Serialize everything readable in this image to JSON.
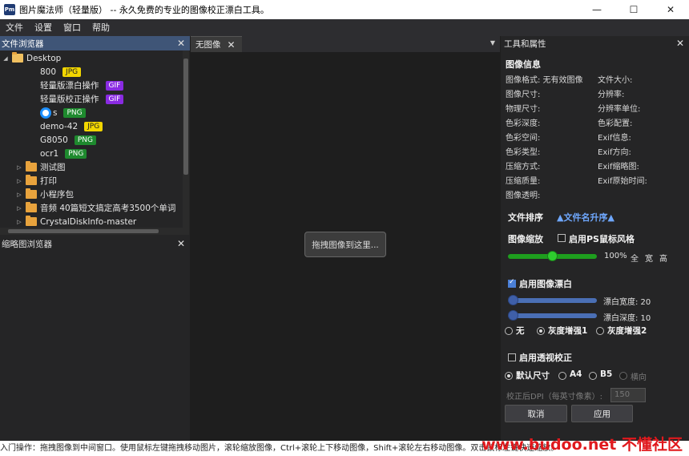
{
  "window": {
    "logo_text": "Pm",
    "title": "图片魔法师（轻量版） -- 永久免费的专业的图像校正漂白工具。",
    "minimize": "—",
    "maximize": "☐",
    "close": "✕"
  },
  "menu": [
    "文件",
    "设置",
    "窗口",
    "帮助"
  ],
  "file_browser": {
    "title": "文件浏览器",
    "close": "✕",
    "root": "Desktop",
    "files": [
      {
        "name": "800",
        "badge": "JPG"
      },
      {
        "name": "轻量版漂白操作",
        "badge": "GIF"
      },
      {
        "name": "轻量版校正操作",
        "badge": "GIF"
      },
      {
        "name": "s",
        "badge": "PNG"
      },
      {
        "name": "demo-42",
        "badge": "JPG"
      },
      {
        "name": "G8050",
        "badge": "PNG"
      },
      {
        "name": "ocr1",
        "badge": "PNG"
      }
    ],
    "folders": [
      "测试图",
      "打印",
      "小程序包",
      "音频 40篇短文搞定高考3500个单词",
      "CrystalDiskInfo-master"
    ]
  },
  "thumbnail_browser": {
    "title": "缩略图浏览器",
    "close": "✕"
  },
  "center": {
    "tab_label": "无图像",
    "tab_close": "✕",
    "dropdown": "▼",
    "drop_hint": "拖拽图像到这里..."
  },
  "tools": {
    "title": "工具和属性",
    "close": "✕",
    "image_info": {
      "title": "图像信息",
      "left": [
        "图像格式: 无有效图像",
        "图像尺寸:",
        "物理尺寸:",
        "色彩深度:",
        "色彩空间:",
        "色彩类型:",
        "压缩方式:",
        "压缩质量:",
        "图像透明:"
      ],
      "right": [
        "文件大小:",
        "分辨率:",
        "分辨率单位:",
        "色彩配置:",
        "Exif信息:",
        "Exif方向:",
        "Exif缩略图:",
        "Exif原始时间:"
      ]
    },
    "file_sort": {
      "label": "文件排序",
      "value": "▲文件名升序▲"
    },
    "zoom": {
      "label": "图像缩放",
      "ps_style": "启用PS鼠标风格",
      "value_text": "100%",
      "options": [
        "全",
        "宽",
        "高"
      ],
      "slider_fraction": 0.5
    },
    "whitening": {
      "enable_label": "启用图像漂白",
      "width_label": "漂白宽度: 20",
      "depth_label": "漂白深度: 10",
      "width_fraction": 0.0,
      "depth_fraction": 0.0,
      "modes": [
        "无",
        "灰度增强1",
        "灰度增强2"
      ],
      "selected_mode": 1
    },
    "perspective": {
      "enable_label": "启用透视校正",
      "sizes": [
        "默认尺寸",
        "A4",
        "B5",
        "横向"
      ],
      "selected_size": 0,
      "dpi_label": "校正后DPI（每英寸像素）:",
      "dpi_value": "150",
      "cancel": "取消",
      "apply": "应用"
    }
  },
  "status": "入门操作：拖拽图像到中间窗口。使用鼠标左键拖拽移动图片，滚轮缩放图像，Ctrl+滚轮上下移动图像，Shift+滚轮左右移动图像。双击鼠标左键快速缩放。",
  "watermark": "www.budoo.net 不懂社区",
  "colors": {
    "accent_green": "#1e9e1e",
    "accent_blue": "#3f5fa8",
    "jpg": "#f2d600",
    "gif": "#8a2be2",
    "png": "#1e8a2e"
  }
}
